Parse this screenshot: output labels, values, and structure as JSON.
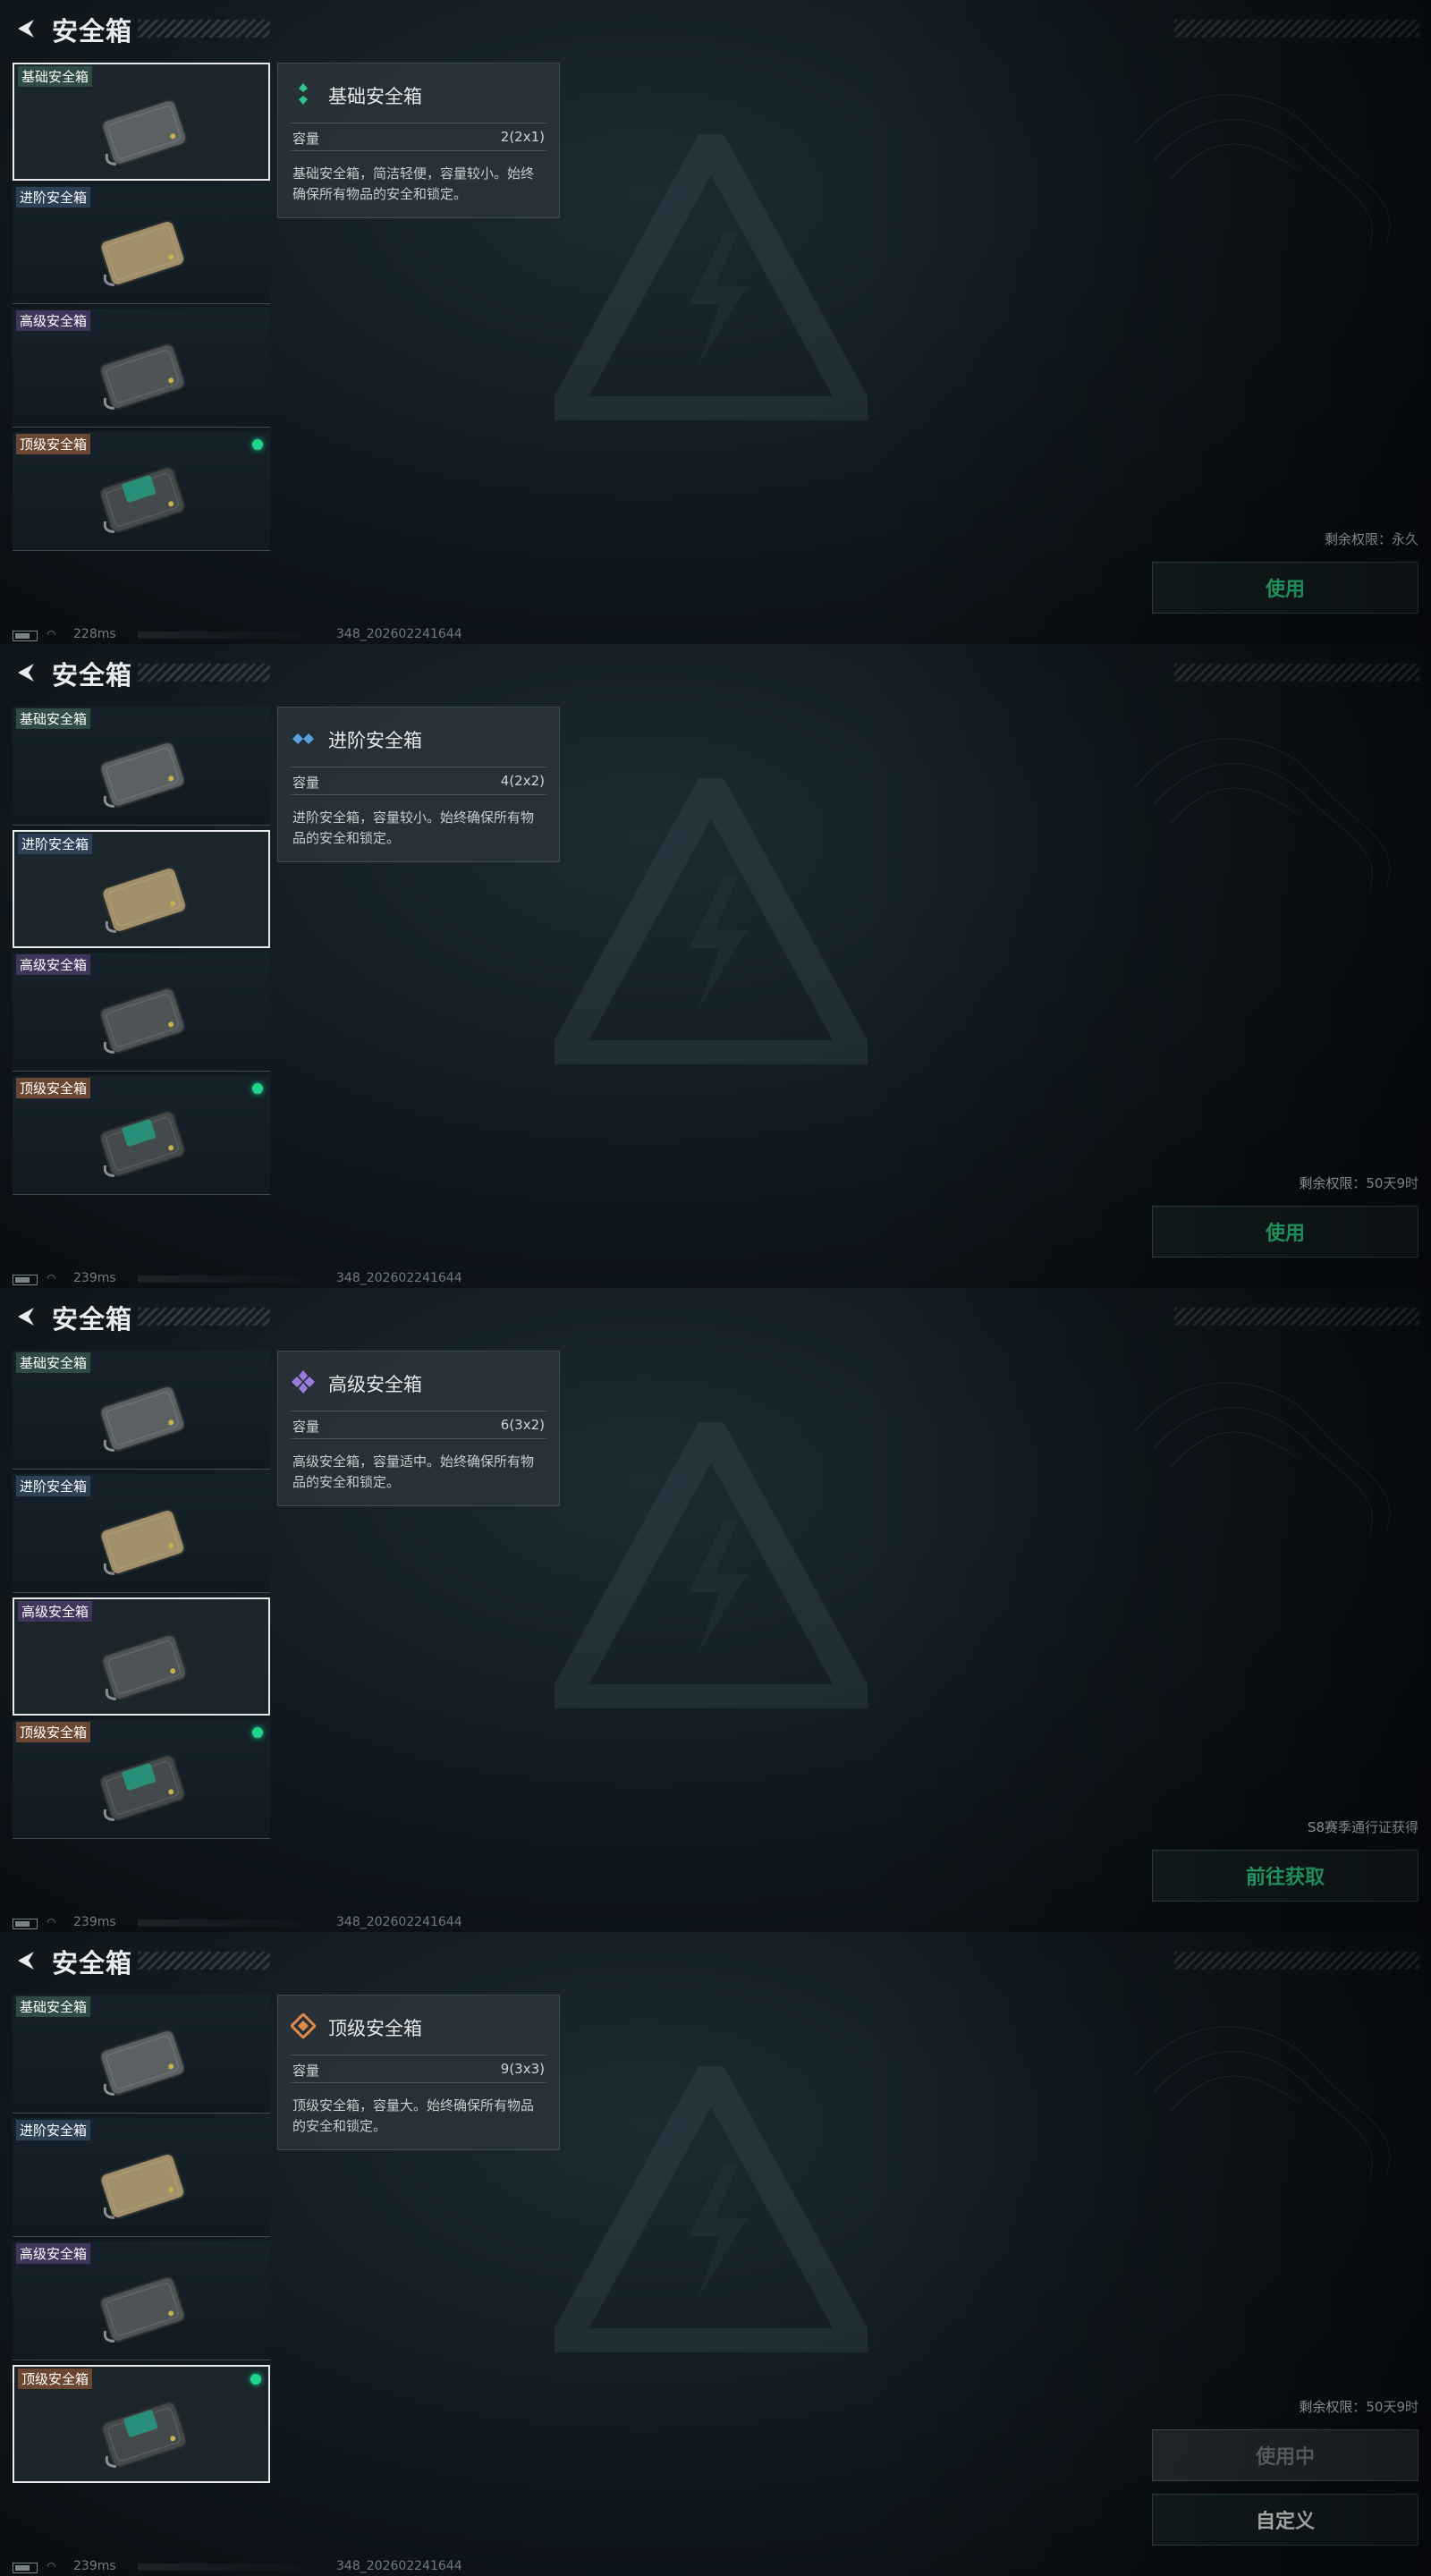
{
  "screen_title": "安全箱",
  "capacity_label": "容量",
  "boxes": [
    {
      "name": "基础安全箱"
    },
    {
      "name": "进阶安全箱"
    },
    {
      "name": "高级安全箱"
    },
    {
      "name": "顶级安全箱"
    }
  ],
  "panels": [
    {
      "selected_index": 0,
      "info": {
        "name": "基础安全箱",
        "capacity": "2(2x1)",
        "desc": "基础安全箱，简洁轻便，容量较小。始终确保所有物品的安全和锁定。",
        "icon": "basic-box-icon",
        "color": "#2fc48d"
      },
      "remain": "剩余权限：永久",
      "buttons": [
        {
          "label": "使用",
          "style": "green"
        }
      ],
      "status": {
        "ping": "228ms",
        "build": "348_202602241644"
      }
    },
    {
      "selected_index": 1,
      "info": {
        "name": "进阶安全箱",
        "capacity": "4(2x2)",
        "desc": "进阶安全箱，容量较小。始终确保所有物品的安全和锁定。",
        "icon": "advanced-box-icon",
        "color": "#5aa0e0"
      },
      "remain": "剩余权限：50天9时",
      "buttons": [
        {
          "label": "使用",
          "style": "green"
        }
      ],
      "status": {
        "ping": "239ms",
        "build": "348_202602241644"
      }
    },
    {
      "selected_index": 2,
      "info": {
        "name": "高级安全箱",
        "capacity": "6(3x2)",
        "desc": "高级安全箱，容量适中。始终确保所有物品的安全和锁定。",
        "icon": "high-box-icon",
        "color": "#9c7ae0"
      },
      "remain": "S8赛季通行证获得",
      "buttons": [
        {
          "label": "前往获取",
          "style": "green"
        }
      ],
      "status": {
        "ping": "239ms",
        "build": "348_202602241644"
      }
    },
    {
      "selected_index": 3,
      "info": {
        "name": "顶级安全箱",
        "capacity": "9(3x3)",
        "desc": "顶级安全箱，容量大。始终确保所有物品的安全和锁定。",
        "icon": "top-box-icon",
        "color": "#e0894a"
      },
      "remain": "剩余权限：50天9时",
      "buttons": [
        {
          "label": "使用中",
          "style": "grey"
        },
        {
          "label": "自定义",
          "style": "white"
        }
      ],
      "status": {
        "ping": "239ms",
        "build": "348_202602241644"
      }
    }
  ]
}
